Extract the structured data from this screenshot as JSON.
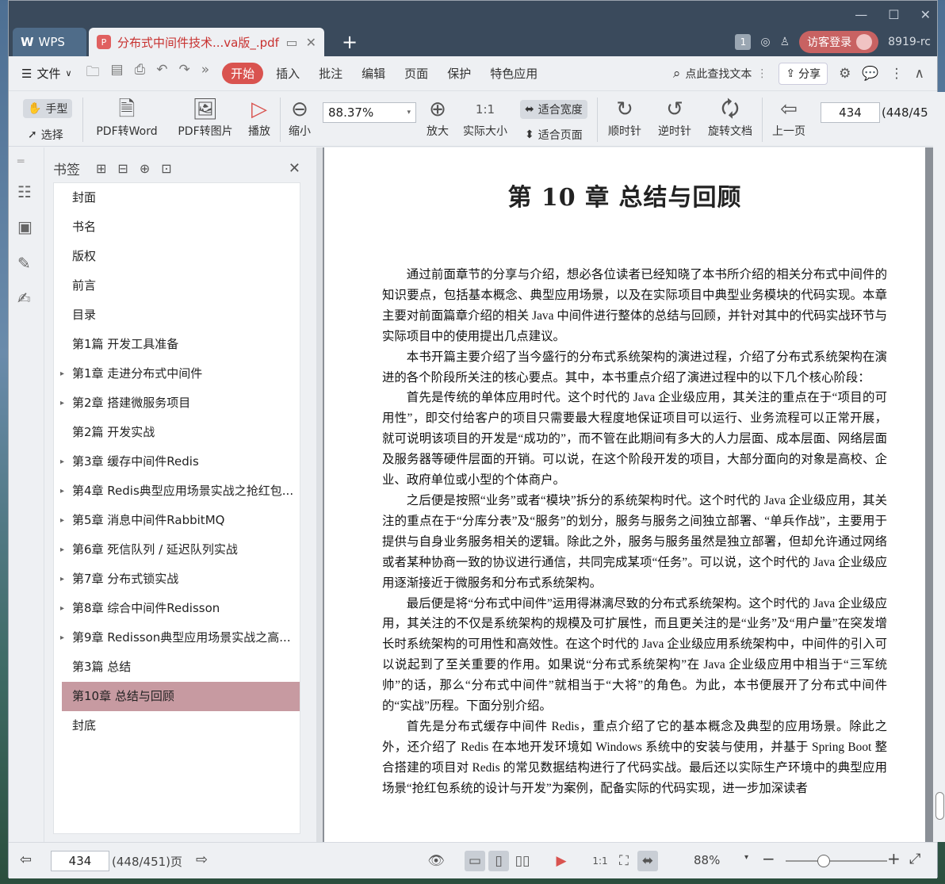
{
  "tabs": {
    "wps_label": "WPS",
    "doc_label": "分布式中间件技术...va版_.pdf"
  },
  "titlebar": {
    "page_badge": "1",
    "login_label": "访客登录",
    "user_id": "8919-rc"
  },
  "menubar": {
    "file_label": "文件",
    "items": [
      "开始",
      "插入",
      "批注",
      "编辑",
      "页面",
      "保护",
      "特色应用"
    ],
    "search_label": "点此查找文本",
    "share_label": "分享"
  },
  "ribbon": {
    "hand_label": "手型",
    "select_label": "选择",
    "pdf_to_word": "PDF转Word",
    "pdf_to_image": "PDF转图片",
    "play": "播放",
    "zoom_out": "缩小",
    "zoom_value": "88.37%",
    "zoom_in": "放大",
    "actual_size": "实际大小",
    "fit_width": "适合宽度",
    "fit_page": "适合页面",
    "clockwise": "顺时针",
    "counter_clockwise": "逆时针",
    "rotate_doc": "旋转文档",
    "prev_page": "上一页",
    "page_input": "434",
    "page_total": "(448/45"
  },
  "bookmarks": {
    "title": "书签",
    "items": [
      {
        "label": "封面",
        "expandable": false
      },
      {
        "label": "书名",
        "expandable": false
      },
      {
        "label": "版权",
        "expandable": false
      },
      {
        "label": "前言",
        "expandable": false
      },
      {
        "label": "目录",
        "expandable": false
      },
      {
        "label": "第1篇  开发工具准备",
        "expandable": false
      },
      {
        "label": "第1章  走进分布式中间件",
        "expandable": true
      },
      {
        "label": "第2章  搭建微服务项目",
        "expandable": true
      },
      {
        "label": "第2篇  开发实战",
        "expandable": false
      },
      {
        "label": "第3章  缓存中间件Redis",
        "expandable": true
      },
      {
        "label": "第4章  Redis典型应用场景实战之抢红包...",
        "expandable": true
      },
      {
        "label": "第5章  消息中间件RabbitMQ",
        "expandable": true
      },
      {
        "label": "第6章  死信队列 / 延迟队列实战",
        "expandable": true
      },
      {
        "label": "第7章  分布式锁实战",
        "expandable": true
      },
      {
        "label": "第8章  综合中间件Redisson",
        "expandable": true
      },
      {
        "label": "第9章  Redisson典型应用场景实战之高...",
        "expandable": true
      },
      {
        "label": "第3篇  总结",
        "expandable": false
      },
      {
        "label": "第10章  总结与回顾",
        "expandable": false,
        "selected": true
      },
      {
        "label": "封底",
        "expandable": false
      }
    ]
  },
  "document": {
    "chapter_title": "第 10 章    总结与回顾",
    "paragraphs": [
      "通过前面章节的分享与介绍，想必各位读者已经知晓了本书所介绍的相关分布式中间件的知识要点，包括基本概念、典型应用场景，以及在实际项目中典型业务模块的代码实现。本章主要对前面篇章介绍的相关 Java 中间件进行整体的总结与回顾，并针对其中的代码实战环节与实际项目中的使用提出几点建议。",
      "本书开篇主要介绍了当今盛行的分布式系统架构的演进过程，介绍了分布式系统架构在演进的各个阶段所关注的核心要点。其中，本书重点介绍了演进过程中的以下几个核心阶段：",
      "首先是传统的单体应用时代。这个时代的 Java 企业级应用，其关注的重点在于“项目的可用性”，即交付给客户的项目只需要最大程度地保证项目可以运行、业务流程可以正常开展，就可说明该项目的开发是“成功的”，而不管在此期间有多大的人力层面、成本层面、网络层面及服务器等硬件层面的开销。可以说，在这个阶段开发的项目，大部分面向的对象是高校、企业、政府单位或小型的个体商户。",
      "之后便是按照“业务”或者“模块”拆分的系统架构时代。这个时代的 Java 企业级应用，其关注的重点在于“分库分表”及“服务”的划分，服务与服务之间独立部署、“单兵作战”，主要用于提供与自身业务服务相关的逻辑。除此之外，服务与服务虽然是独立部署，但却允许通过网络或者某种协商一致的协议进行通信，共同完成某项“任务”。可以说，这个时代的 Java 企业级应用逐渐接近于微服务和分布式系统架构。",
      "最后便是将“分布式中间件”运用得淋漓尽致的分布式系统架构。这个时代的 Java 企业级应用，其关注的不仅是系统架构的规模及可扩展性，而且更关注的是“业务”及“用户量”在突发增长时系统架构的可用性和高效性。在这个时代的 Java 企业级应用系统架构中，中间件的引入可以说起到了至关重要的作用。如果说“分布式系统架构”在 Java 企业级应用中相当于“三军统帅”的话，那么“分布式中间件”就相当于“大将”的角色。为此，本书便展开了分布式中间件的“实战”历程。下面分别介绍。",
      "首先是分布式缓存中间件 Redis，重点介绍了它的基本概念及典型的应用场景。除此之外，还介绍了 Redis 在本地开发环境如 Windows 系统中的安装与使用，并基于 Spring Boot 整合搭建的项目对 Redis 的常见数据结构进行了代码实战。最后还以实际生产环境中的典型应用场景“抢红包系统的设计与开发”为案例，配备实际的代码实现，进一步加深读者"
    ]
  },
  "statusbar": {
    "page_input": "434",
    "page_total": "(448/451)页",
    "zoom": "88%"
  }
}
